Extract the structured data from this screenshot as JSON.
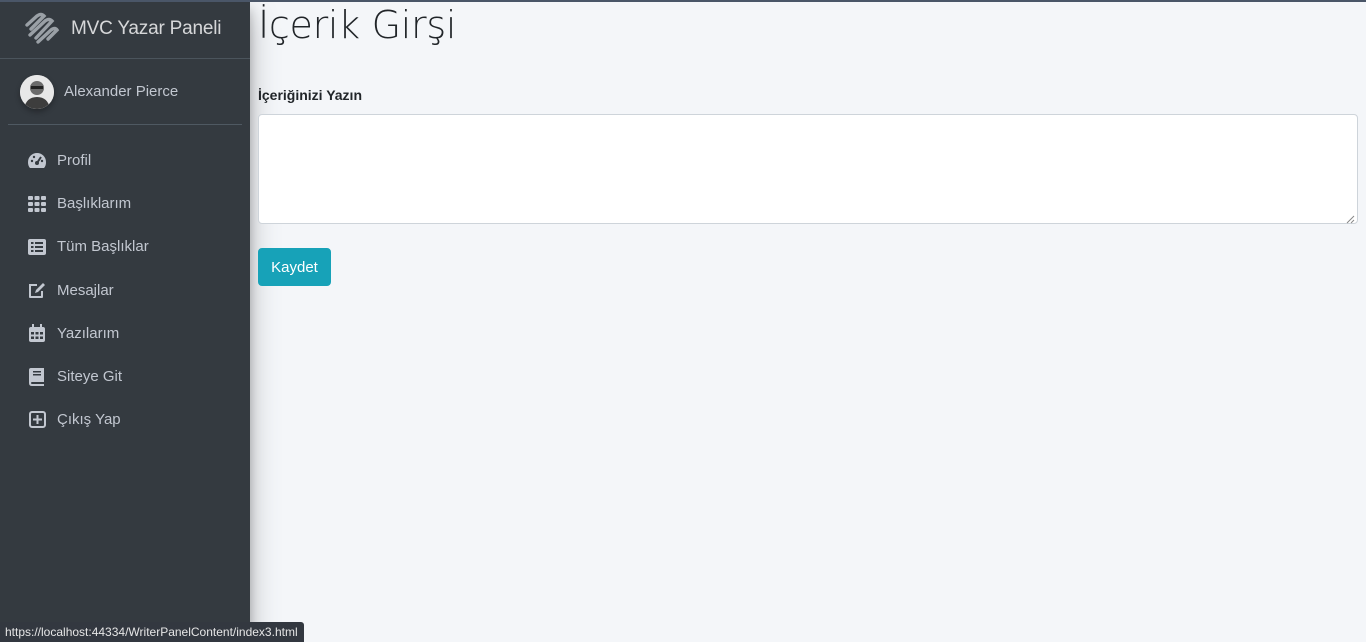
{
  "brand": {
    "title": "MVC Yazar Paneli",
    "logo_icon": "brand-swirl-logo"
  },
  "user": {
    "name": "Alexander Pierce"
  },
  "sidebar": {
    "items": [
      {
        "label": "Profil",
        "icon": "tachometer-icon"
      },
      {
        "label": "Başlıklarım",
        "icon": "grid-icon"
      },
      {
        "label": "Tüm Başlıklar",
        "icon": "list-alt-icon"
      },
      {
        "label": "Mesajlar",
        "icon": "edit-icon"
      },
      {
        "label": "Yazılarım",
        "icon": "calendar-icon"
      },
      {
        "label": "Siteye Git",
        "icon": "book-icon"
      },
      {
        "label": "Çıkış Yap",
        "icon": "plus-square-icon"
      }
    ]
  },
  "main": {
    "title": "İçerik Girşi",
    "form": {
      "label": "İçeriğinizi Yazın",
      "textarea_value": "",
      "submit_label": "Kaydet"
    }
  },
  "status_bar": {
    "url": "https://localhost:44334/WriterPanelContent/index3.html"
  },
  "colors": {
    "sidebar_bg": "#343a40",
    "accent": "#17a2b8",
    "content_bg": "#f4f6f9"
  }
}
